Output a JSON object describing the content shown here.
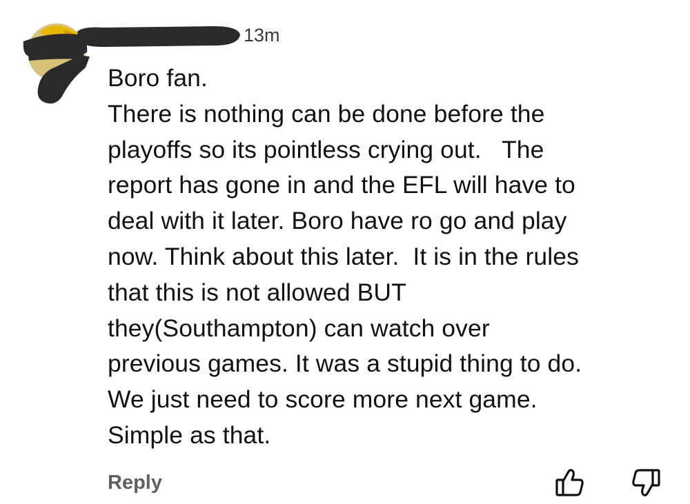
{
  "comment": {
    "timestamp": "13m",
    "lines": [
      "Boro fan.",
      "There is nothing can be done before the",
      "playoffs so its pointless crying out.   The",
      "report has gone in and the EFL will have to",
      "deal with it later. Boro have ro go and play",
      "now. Think about this later.  It is in the rules",
      "that this is not allowed BUT",
      "they(Southampton) can watch over",
      "previous games. It was a stupid thing to do.",
      "We just need to score more next game.",
      "Simple as that."
    ],
    "reply_label": "Reply"
  },
  "icons": {
    "like": "thumbs-up-icon",
    "dislike": "thumbs-down-icon"
  },
  "colors": {
    "text": "#111111",
    "meta": "#3a3a3a",
    "reply": "#606060",
    "redaction": "#2a2a2a",
    "avatar_accent": "#e8b800"
  }
}
